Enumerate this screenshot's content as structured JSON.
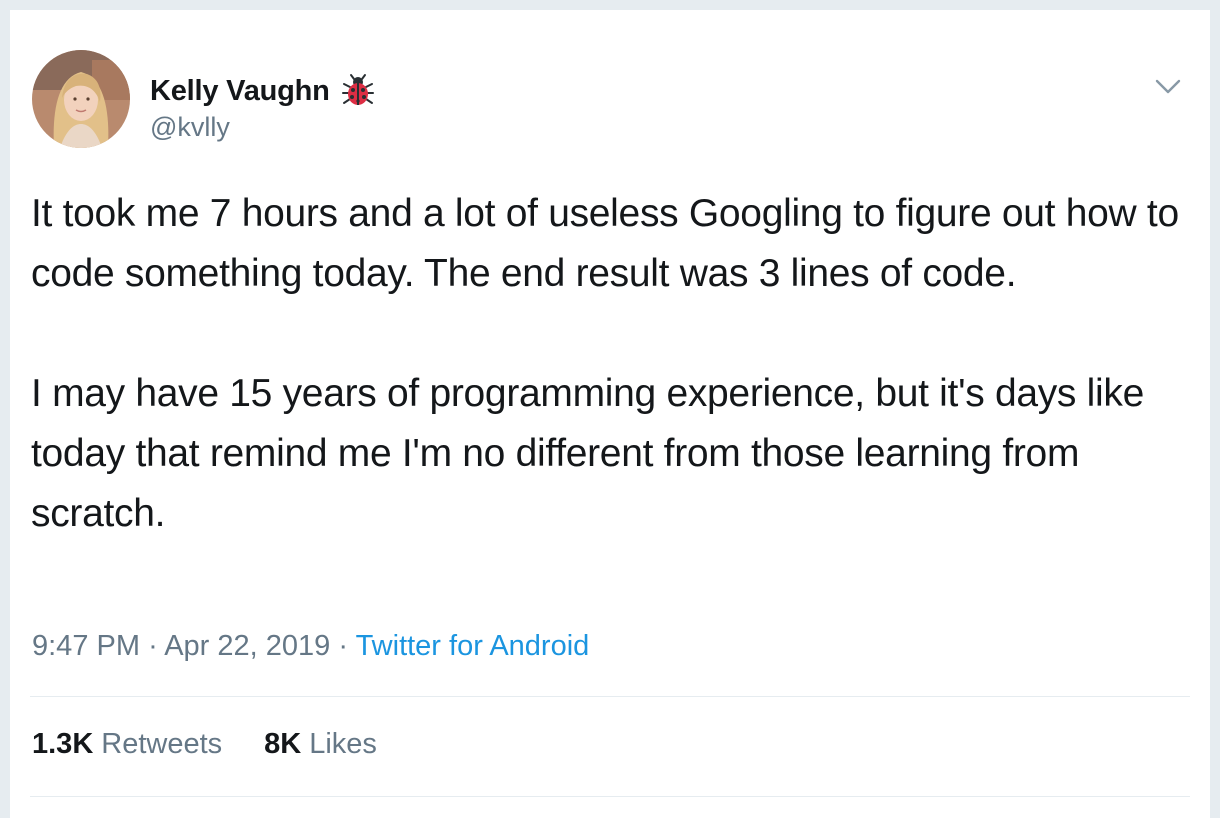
{
  "tweet": {
    "author": {
      "display_name": "Kelly Vaughn",
      "handle": "@kvlly",
      "name_emoji": "ladybug-icon"
    },
    "body": [
      "It took me 7 hours and a lot of useless Googling to figure out how to code something today. The end result was 3 lines of code.",
      "I may have 15 years of programming experience, but it's days like today that remind me I'm no different from those learning from scratch."
    ],
    "meta": {
      "time": "9:47 PM",
      "separator": "·",
      "date": "Apr 22, 2019",
      "source": "Twitter for Android"
    },
    "stats": {
      "retweets_count": "1.3K",
      "retweets_label": "Retweets",
      "likes_count": "8K",
      "likes_label": "Likes"
    },
    "menu_icon": "chevron-down-icon"
  },
  "colors": {
    "background": "#e6ecf0",
    "text_primary": "#14171a",
    "text_secondary": "#657786",
    "link": "#1b95e0"
  }
}
